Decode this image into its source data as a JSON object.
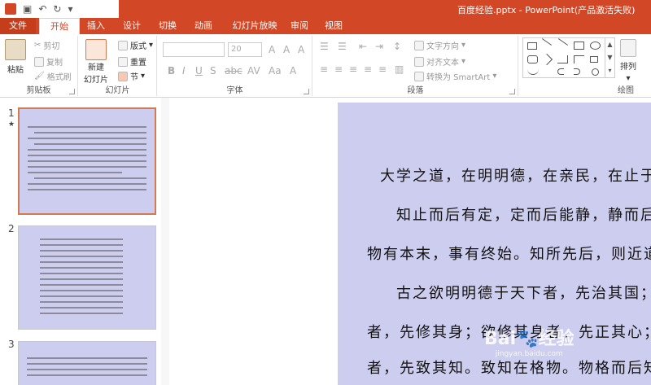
{
  "window": {
    "title": "百度经验.pptx - PowerPoint(产品激活失败)"
  },
  "quick_access": {
    "icons": [
      "powerpoint-logo-icon",
      "save-icon",
      "undo-icon",
      "redo-icon",
      "customize-icon"
    ]
  },
  "tabs": [
    {
      "label": "文件"
    },
    {
      "label": "开始"
    },
    {
      "label": "插入"
    },
    {
      "label": "设计"
    },
    {
      "label": "切换"
    },
    {
      "label": "动画"
    },
    {
      "label": "幻灯片放映"
    },
    {
      "label": "审阅"
    },
    {
      "label": "视图"
    }
  ],
  "ribbon": {
    "clipboard": {
      "label": "剪贴板",
      "paste": "粘贴",
      "cut": "剪切",
      "copy": "复制",
      "format_painter": "格式刷"
    },
    "slides": {
      "label": "幻灯片",
      "new_slide_line1": "新建",
      "new_slide_line2": "幻灯片",
      "layout": "版式",
      "reset": "重置",
      "section": "节"
    },
    "font": {
      "label": "字体",
      "font_size": "20"
    },
    "paragraph": {
      "label": "段落",
      "text_direction": "文字方向",
      "align_text": "对齐文本",
      "convert_smartart": "转换为 SmartArt"
    },
    "drawing": {
      "label": "绘图",
      "arrange": "排列"
    }
  },
  "thumbnails": [
    {
      "number": "1",
      "star": "★"
    },
    {
      "number": "2"
    },
    {
      "number": "3"
    }
  ],
  "slide": {
    "lines": [
      "大学之道，在明明德，在亲民，在止于",
      "知止而后有定，定而后能静，静而后",
      "物有本末，事有终始。知所先后，则近道",
      "古之欲明明德于天下者，先治其国；",
      "者，先修其身；欲修其身者，先正其心；",
      "者，先致其知。致知在格物。物格而后知"
    ]
  },
  "watermark": {
    "text": "Bai🐾经验",
    "url": "jingyan.baidu.com"
  }
}
